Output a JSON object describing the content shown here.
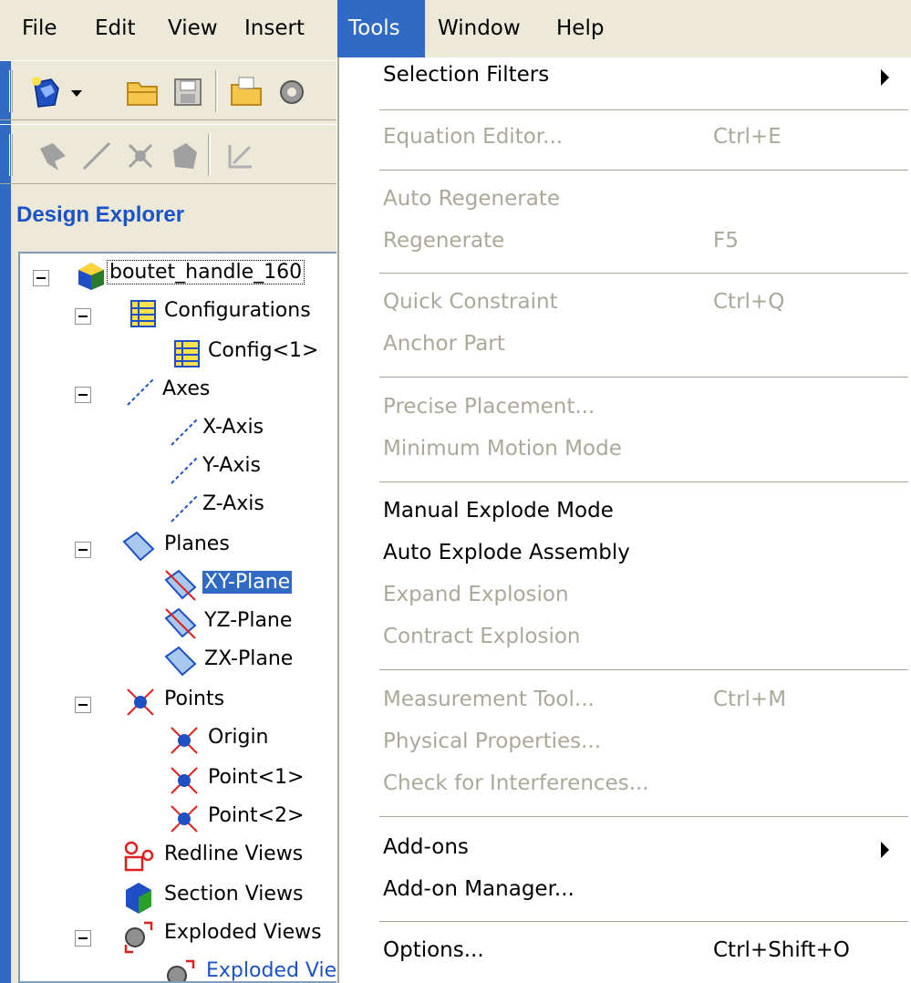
{
  "menubar": {
    "items": [
      {
        "label": "File"
      },
      {
        "label": "Edit"
      },
      {
        "label": "View"
      },
      {
        "label": "Insert"
      },
      {
        "label": "Tools",
        "active": true
      },
      {
        "label": "Window"
      },
      {
        "label": "Help"
      }
    ]
  },
  "explorer": {
    "title": "Design Explorer",
    "tree": {
      "root": "boutet_handle_160",
      "configurations": "Configurations",
      "config1": "Config<1>",
      "axes": "Axes",
      "x_axis": "X-Axis",
      "y_axis": "Y-Axis",
      "z_axis": "Z-Axis",
      "planes": "Planes",
      "xy_plane": "XY-Plane",
      "yz_plane": "YZ-Plane",
      "zx_plane": "ZX-Plane",
      "points": "Points",
      "origin": "Origin",
      "point1": "Point<1>",
      "point2": "Point<2>",
      "redline_views": "Redline Views",
      "section_views": "Section Views",
      "exploded_views": "Exploded Views",
      "exploded_view_item": "Exploded View"
    }
  },
  "tools_menu": {
    "selection_filters": {
      "label": "Selection Filters",
      "shortcut": ""
    },
    "equation_editor": {
      "label": "Equation Editor...",
      "shortcut": "Ctrl+E"
    },
    "auto_regenerate": {
      "label": "Auto Regenerate",
      "shortcut": ""
    },
    "regenerate": {
      "label": "Regenerate",
      "shortcut": "F5"
    },
    "quick_constraint": {
      "label": "Quick Constraint",
      "shortcut": "Ctrl+Q"
    },
    "anchor_part": {
      "label": "Anchor Part",
      "shortcut": ""
    },
    "precise_placement": {
      "label": "Precise Placement...",
      "shortcut": ""
    },
    "minimum_motion_mode": {
      "label": "Minimum Motion Mode",
      "shortcut": ""
    },
    "manual_explode_mode": {
      "label": "Manual Explode Mode",
      "shortcut": ""
    },
    "auto_explode_assembly": {
      "label": "Auto Explode Assembly",
      "shortcut": ""
    },
    "expand_explosion": {
      "label": "Expand Explosion",
      "shortcut": ""
    },
    "contract_explosion": {
      "label": "Contract Explosion",
      "shortcut": ""
    },
    "measurement_tool": {
      "label": "Measurement Tool...",
      "shortcut": "Ctrl+M"
    },
    "physical_properties": {
      "label": "Physical Properties...",
      "shortcut": ""
    },
    "check_interferences": {
      "label": "Check for Interferences...",
      "shortcut": ""
    },
    "add_ons": {
      "label": "Add-ons",
      "shortcut": ""
    },
    "add_on_manager": {
      "label": "Add-on Manager...",
      "shortcut": ""
    },
    "options": {
      "label": "Options...",
      "shortcut": "Ctrl+Shift+O"
    }
  },
  "colors": {
    "highlight": "#316ac5",
    "menu_face": "#ece9d8",
    "disabled_text": "#aca899",
    "explorer_title": "#1c52c8"
  }
}
